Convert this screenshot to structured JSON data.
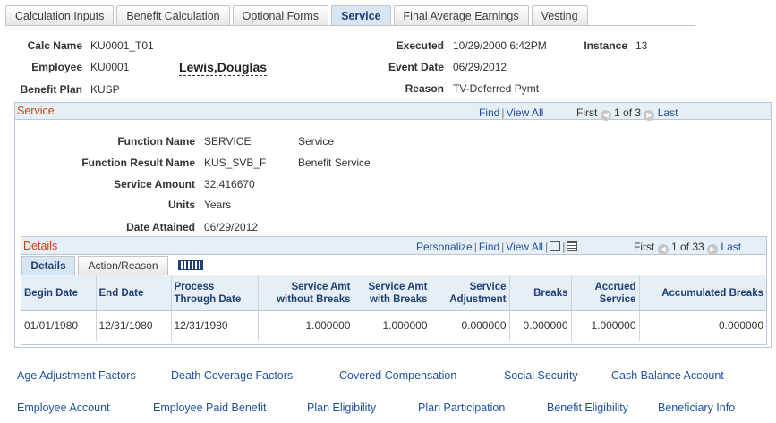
{
  "tabs": [
    {
      "label": "Calculation Inputs"
    },
    {
      "label": "Benefit Calculation"
    },
    {
      "label": "Optional Forms"
    },
    {
      "label": "Service"
    },
    {
      "label": "Final Average Earnings"
    },
    {
      "label": "Vesting"
    }
  ],
  "header": {
    "calc_name_label": "Calc Name",
    "calc_name": "KU0001_T01",
    "employee_label": "Employee",
    "employee_id": "KU0001",
    "employee_name": "Lewis,Douglas",
    "benefit_plan_label": "Benefit Plan",
    "benefit_plan": "KUSP",
    "executed_label": "Executed",
    "executed": "10/29/2000  6:42PM",
    "instance_label": "Instance",
    "instance": "13",
    "event_date_label": "Event Date",
    "event_date": "06/29/2012",
    "reason_label": "Reason",
    "reason": "TV-Deferred Pymt"
  },
  "service": {
    "title": "Service",
    "find": "Find",
    "view_all": "View All",
    "first": "First",
    "pager": "1 of 3",
    "last": "Last",
    "function_name_label": "Function Name",
    "function_name": "SERVICE",
    "function_name_desc": "Service",
    "function_result_label": "Function Result Name",
    "function_result": "KUS_SVB_F",
    "function_result_desc": "Benefit Service",
    "service_amount_label": "Service Amount",
    "service_amount": "32.416670",
    "units_label": "Units",
    "units": "Years",
    "date_attained_label": "Date Attained",
    "date_attained": "06/29/2012"
  },
  "details": {
    "title": "Details",
    "personalize": "Personalize",
    "find": "Find",
    "view_all": "View All",
    "first": "First",
    "pager": "1 of 33",
    "last": "Last",
    "tab_details": "Details",
    "tab_action": "Action/Reason",
    "columns": [
      "Begin Date",
      "End Date",
      "Process Through Date",
      "Service Amt without Breaks",
      "Service Amt with Breaks",
      "Service Adjustment",
      "Breaks",
      "Accrued Service",
      "Accumulated Breaks"
    ],
    "rows": [
      [
        "01/01/1980",
        "12/31/1980",
        "12/31/1980",
        "1.000000",
        "1.000000",
        "0.000000",
        "0.000000",
        "1.000000",
        "0.000000"
      ]
    ]
  },
  "links_row1": [
    "Age Adjustment Factors",
    "Death Coverage Factors",
    "Covered Compensation",
    "Social Security",
    "Cash Balance Account"
  ],
  "links_row2": [
    "Employee Account",
    "Employee Paid Benefit",
    "Plan Eligibility",
    "Plan Participation",
    "Benefit Eligibility",
    "Beneficiary Info"
  ]
}
